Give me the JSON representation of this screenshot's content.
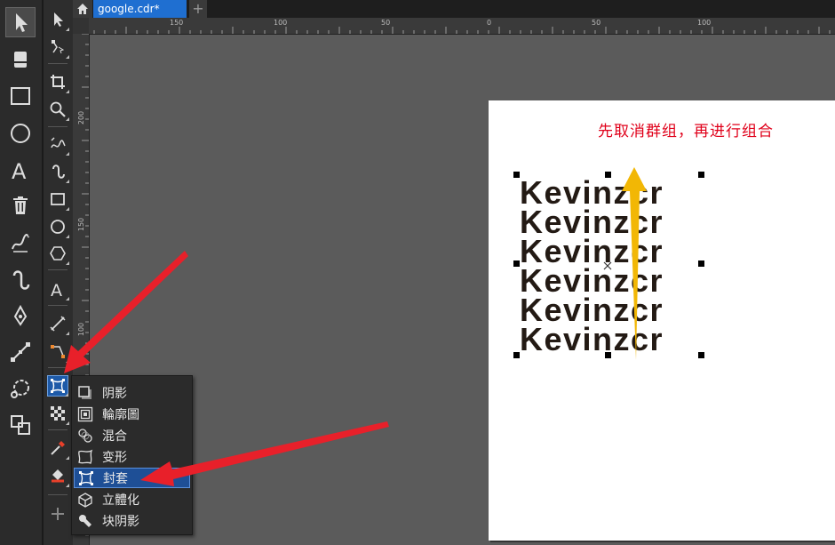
{
  "tabs": {
    "home_icon": "home-icon",
    "document": "google.cdr*",
    "add": "+"
  },
  "ruler": {
    "h_labels": [
      "150",
      "100",
      "50",
      "0",
      "50",
      "100"
    ],
    "v_labels": [
      "200",
      "150",
      "100"
    ]
  },
  "dock_icons": [
    "pointer-icon",
    "eraser-icon",
    "rectangle-icon",
    "ellipse-icon",
    "text-icon",
    "trash-icon",
    "artistic-media-icon",
    "curve-icon",
    "pen-icon",
    "connector-icon",
    "lasso-icon",
    "shapes-icon"
  ],
  "toolbox_icons": [
    "pick-tool-icon",
    "shape-tool-icon",
    "crop-tool-icon",
    "zoom-tool-icon",
    "freehand-tool-icon",
    "artistic-media-tool-icon",
    "rectangle-tool-icon",
    "ellipse-tool-icon",
    "polygon-tool-icon",
    "text-tool-icon",
    "dimension-tool-icon",
    "connector-tool-icon",
    "envelope-tool-icon",
    "transparency-tool-icon",
    "eyedropper-tool-icon",
    "fill-tool-icon",
    "add-tool-icon"
  ],
  "canvas": {
    "annotation": "先取消群组，再进行组合",
    "text_lines": [
      "Kevinzcr",
      "Kevinzcr",
      "Kevinzcr",
      "Kevinzcr",
      "Kevinzcr",
      "Kevinzcr"
    ],
    "annotation_color": "#e0001a",
    "arrow_color": "#f2b705"
  },
  "flyout": {
    "items": [
      {
        "label": "阴影",
        "icon": "drop-shadow-icon"
      },
      {
        "label": "輪廓圖",
        "icon": "contour-icon"
      },
      {
        "label": "混合",
        "icon": "blend-icon"
      },
      {
        "label": "变形",
        "icon": "distort-icon"
      },
      {
        "label": "封套",
        "icon": "envelope-icon",
        "selected": true
      },
      {
        "label": "立體化",
        "icon": "extrude-icon"
      },
      {
        "label": "块阴影",
        "icon": "block-shadow-icon"
      }
    ]
  },
  "colors": {
    "accent": "#1f6fd1",
    "pointer_arrows": "#e8202a"
  }
}
